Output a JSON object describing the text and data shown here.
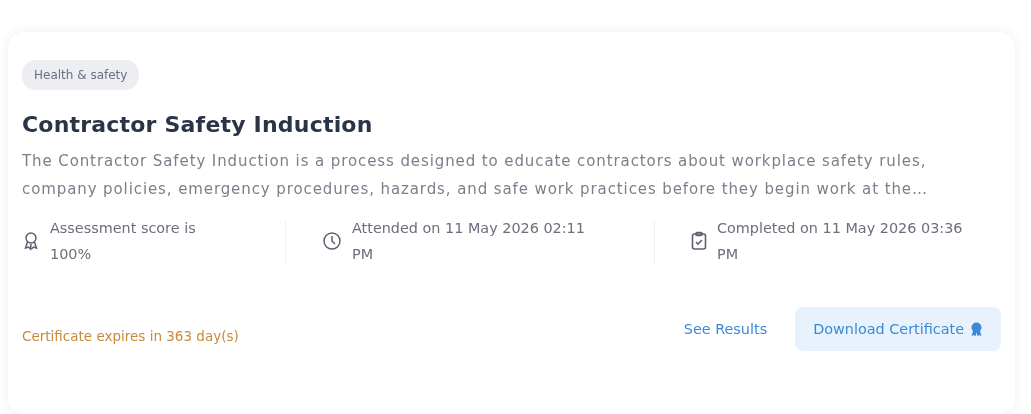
{
  "course_card": {
    "category_tag": "Health & safety",
    "title": "Contractor Safety Induction",
    "description": "The Contractor Safety Induction is a process designed to educate contractors about workplace safety rules, company policies, emergency procedures, hazards, and safe work practices before they begin work at the…",
    "meta": [
      {
        "kind": "award",
        "text": "Assessment score is 100%"
      },
      {
        "kind": "clock",
        "text": "Attended on 11 May 2026 02:11 PM"
      },
      {
        "kind": "clipboard",
        "text": "Completed on 11 May 2026 03:36 PM"
      }
    ],
    "expiry_note": "Certificate expires in 363 day(s)",
    "actions": [
      {
        "kind": "link",
        "label": "See Results"
      },
      {
        "kind": "primary",
        "label": "Download Certificate"
      }
    ]
  }
}
